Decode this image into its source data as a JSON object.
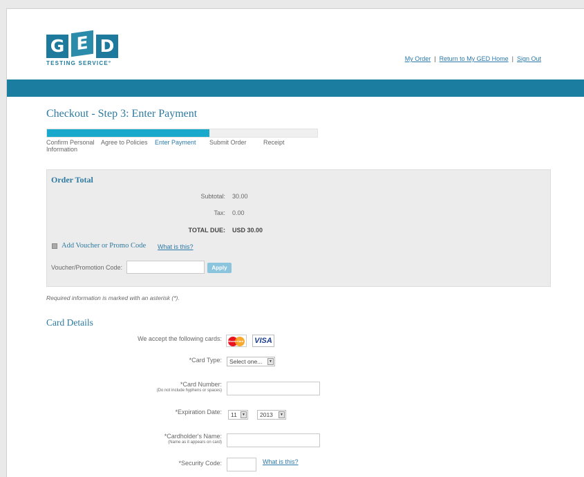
{
  "header": {
    "logo_letters": [
      "G",
      "E",
      "D"
    ],
    "logo_tagline": "TESTING SERVICE°",
    "brand_color": "#1e7a9c",
    "links": [
      "My Order",
      "Return to My GED Home",
      "Sign Out"
    ]
  },
  "checkout": {
    "title": "Checkout - Step 3: Enter Payment",
    "progress_fraction": 0.6,
    "steps": [
      {
        "line1": "Confirm Personal",
        "line2": "Information"
      },
      {
        "line1": "Agree to Policies",
        "line2": ""
      },
      {
        "line1": "Enter Payment",
        "line2": ""
      },
      {
        "line1": "Submit Order",
        "line2": ""
      },
      {
        "line1": "Receipt",
        "line2": ""
      }
    ]
  },
  "order_total": {
    "title": "Order Total",
    "subtotal_label": "Subtotal:",
    "subtotal_value": "30.00",
    "tax_label": "Tax:",
    "tax_value": "0.00",
    "total_label": "TOTAL DUE:",
    "total_value": "USD 30.00",
    "voucher_toggle_label": "Add Voucher or Promo Code",
    "voucher_help": "What is this?",
    "voucher_field_label": "Voucher/Promotion Code:",
    "voucher_value": "",
    "apply_label": "Apply"
  },
  "required_note": "Required information is marked with an asterisk (*).",
  "card_details": {
    "title": "Card Details",
    "accept_label": "We accept the following cards:",
    "accepted_cards": [
      "MasterCard",
      "VISA"
    ],
    "card_type_label": "*Card Type:",
    "card_type_value": "Select one...",
    "card_number_label": "*Card Number:",
    "card_number_hint": "(Do not include hyphens or spaces)",
    "card_number_value": "",
    "expiration_label": "*Expiration Date:",
    "expiration_month": "11",
    "expiration_year": "2013",
    "cardholder_label": "*Cardholder's Name:",
    "cardholder_hint": "(Name as it appears on card)",
    "cardholder_value": "",
    "security_label": "*Security Code:",
    "security_value": "",
    "security_help": "What is this?"
  }
}
